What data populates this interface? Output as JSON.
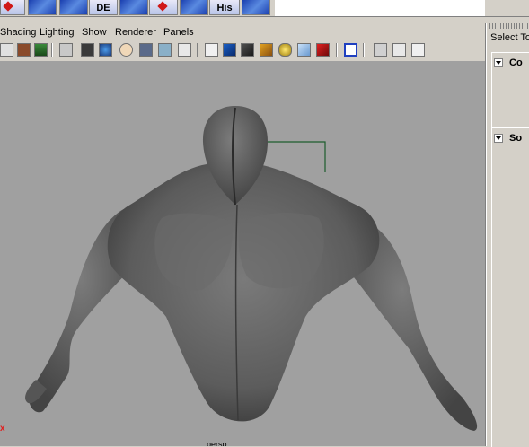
{
  "shelf": {
    "buttons": [
      {
        "name": "shelf-tool-1",
        "label": ""
      },
      {
        "name": "shelf-tool-2",
        "label": ""
      },
      {
        "name": "shelf-tool-3",
        "label": ""
      },
      {
        "name": "shelf-tool-de",
        "label": "DE"
      },
      {
        "name": "shelf-tool-5",
        "label": ""
      },
      {
        "name": "shelf-tool-6",
        "label": ""
      },
      {
        "name": "shelf-tool-7",
        "label": ""
      },
      {
        "name": "shelf-tool-his",
        "label": "His"
      },
      {
        "name": "shelf-tool-9",
        "label": ""
      }
    ]
  },
  "viewport": {
    "menus": [
      "Shading",
      "Lighting",
      "Show",
      "Renderer",
      "Panels"
    ],
    "camera_label": "persp",
    "axis_label": "x"
  },
  "right_panel": {
    "title": "Select To",
    "sections": [
      {
        "label": "Co"
      },
      {
        "label": "So"
      }
    ]
  },
  "colors": {
    "viewport_bg": "#a0a0a0",
    "model_gray": "#5c5c5c",
    "selection_green": "#1c5c2c"
  }
}
